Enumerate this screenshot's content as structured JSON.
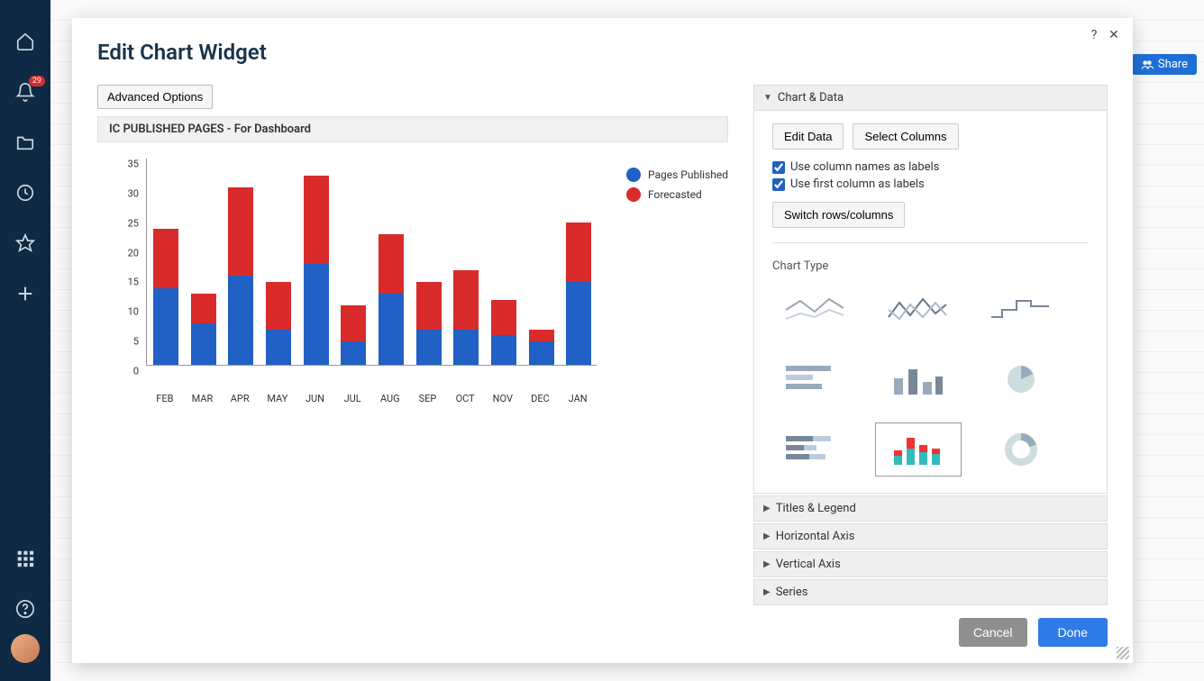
{
  "sidebar": {
    "notification_count": "29"
  },
  "header": {
    "share_label": "Share"
  },
  "modal": {
    "title": "Edit Chart Widget",
    "advanced_options": "Advanced Options",
    "chart_title": "IC PUBLISHED PAGES - For Dashboard",
    "legend": {
      "series1": "Pages Published",
      "series2": "Forecasted"
    },
    "right": {
      "chart_and_data": "Chart & Data",
      "edit_data": "Edit Data",
      "select_columns": "Select Columns",
      "use_col_names": "Use column names as labels",
      "use_first_col": "Use first column as labels",
      "switch_rows": "Switch rows/columns",
      "chart_type_label": "Chart Type",
      "titles_legend": "Titles & Legend",
      "horizontal_axis": "Horizontal Axis",
      "vertical_axis": "Vertical Axis",
      "series": "Series"
    },
    "footer": {
      "cancel": "Cancel",
      "done": "Done"
    }
  },
  "chart_data": {
    "type": "bar",
    "stacked": true,
    "categories": [
      "FEB",
      "MAR",
      "APR",
      "MAY",
      "JUN",
      "JUL",
      "AUG",
      "SEP",
      "OCT",
      "NOV",
      "DEC",
      "JAN"
    ],
    "series": [
      {
        "name": "Pages Published",
        "color": "#2160c4",
        "values": [
          13,
          7,
          15,
          6,
          17,
          4,
          12,
          6,
          6,
          5,
          4,
          14
        ]
      },
      {
        "name": "Forecasted",
        "color": "#d92b2b",
        "values": [
          10,
          5,
          15,
          8,
          15,
          6,
          10,
          8,
          10,
          6,
          2,
          10
        ]
      }
    ],
    "ylim": [
      0,
      35
    ],
    "ystep": 5,
    "title": "IC PUBLISHED PAGES - For Dashboard",
    "xlabel": "",
    "ylabel": ""
  },
  "chart_type_names": [
    "line",
    "multi-line",
    "step-line",
    "horizontal-bar",
    "bar",
    "pie",
    "stacked-horizontal-bar",
    "stacked-bar",
    "donut"
  ],
  "chart_type_selected": "stacked-bar"
}
